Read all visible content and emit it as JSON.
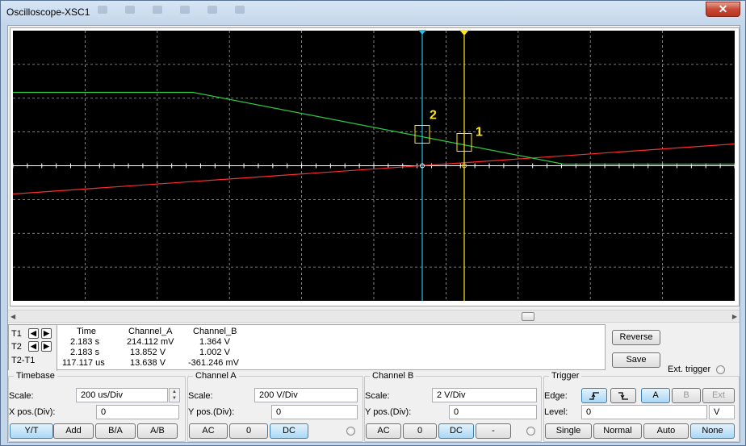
{
  "window": {
    "title": "Oscilloscope-XSC1",
    "close_label": "✕"
  },
  "display": {
    "background": "#000000",
    "grid_color": "#c8c8c8",
    "channel_a_color": "#ff2d2d",
    "channel_b_color": "#2ecc40",
    "cursor1_color": "#ffe51c",
    "cursor2_color": "#23c2e6",
    "cursor1_label": "1",
    "cursor2_label": "2",
    "h_divisions": 10,
    "v_divisions": 8
  },
  "readout": {
    "rows": {
      "t1": {
        "label": "T1"
      },
      "t2": {
        "label": "T2"
      },
      "diff": {
        "label": "T2-T1"
      }
    },
    "headers": {
      "time": "Time",
      "channel_a": "Channel_A",
      "channel_b": "Channel_B"
    },
    "t1": {
      "time": "2.183 s",
      "channel_a": "214.112 mV",
      "channel_b": "1.364 V"
    },
    "t2": {
      "time": "2.183 s",
      "channel_a": "13.852 V",
      "channel_b": "1.002 V"
    },
    "diff": {
      "time": "117.117 us",
      "channel_a": "13.638 V",
      "channel_b": "-361.246 mV"
    },
    "reverse_label": "Reverse",
    "save_label": "Save",
    "ext_trigger_label": "Ext. trigger"
  },
  "timebase": {
    "title": "Timebase",
    "scale_label": "Scale:",
    "scale_value": "200 us/Div",
    "xpos_label": "X pos.(Div):",
    "xpos_value": "0",
    "buttons": [
      "Y/T",
      "Add",
      "B/A",
      "A/B"
    ],
    "active": "Y/T"
  },
  "channel_a": {
    "title": "Channel A",
    "scale_label": "Scale:",
    "scale_value": "200  V/Div",
    "ypos_label": "Y pos.(Div):",
    "ypos_value": "0",
    "buttons": [
      "AC",
      "0",
      "DC"
    ],
    "active": "DC"
  },
  "channel_b": {
    "title": "Channel B",
    "scale_label": "Scale:",
    "scale_value": "2  V/Div",
    "ypos_label": "Y pos.(Div):",
    "ypos_value": "0",
    "buttons": [
      "AC",
      "0",
      "DC",
      "-"
    ],
    "active": "DC"
  },
  "trigger": {
    "title": "Trigger",
    "edge_label": "Edge:",
    "edge_rising": "⎍",
    "edge_falling": "⎍",
    "source_buttons": [
      "A",
      "B",
      "Ext"
    ],
    "active_source": "A",
    "level_label": "Level:",
    "level_value": "0",
    "level_unit": "V",
    "mode_buttons": [
      "Single",
      "Normal",
      "Auto",
      "None"
    ],
    "active_mode": "None"
  }
}
